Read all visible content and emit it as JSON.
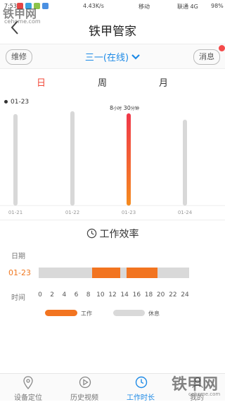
{
  "status_bar": {
    "time": "7:53",
    "speed": "4.43K/s",
    "carrier1": "移动",
    "carrier2": "联通 4G",
    "battery": "98%"
  },
  "watermark": {
    "top_text": "铁甲网",
    "top_sub": "cehome.com",
    "bottom_text": "铁甲网",
    "bottom_sub": "cehome.com"
  },
  "header": {
    "back_icon": "chevron-left-icon",
    "title": "铁甲管家"
  },
  "subbar": {
    "left_pill": "维修",
    "device": "三一(在线)",
    "right_pill": "消息"
  },
  "tabs": [
    {
      "label": "日",
      "active": true
    },
    {
      "label": "周",
      "active": false
    },
    {
      "label": "月",
      "active": false
    }
  ],
  "chart_data": {
    "type": "bar",
    "current_date": "01-23",
    "categories": [
      "01-21",
      "01-22",
      "01-23",
      "01-24"
    ],
    "values_hours": [
      0,
      0,
      8.5,
      0
    ],
    "selected_index": 2,
    "label_hours": "8",
    "label_hours_unit": "小时",
    "label_minutes": "30",
    "label_minutes_unit": "分钟",
    "colors": {
      "inactive": "#d8d8d8",
      "active_top": "#f0374a",
      "active_bottom": "#f58b1e"
    }
  },
  "efficiency": {
    "title": "工作效率",
    "date_label": "日期",
    "row_date": "01-23",
    "time_label": "时间",
    "ticks": [
      "0",
      "2",
      "4",
      "6",
      "8",
      "10",
      "12",
      "14",
      "16",
      "18",
      "20",
      "22",
      "24"
    ],
    "work_segments": [
      [
        8.5,
        13
      ],
      [
        14,
        19
      ]
    ],
    "legend_work": "工作",
    "legend_rest": "休息",
    "colors": {
      "work": "#f27420",
      "rest": "#d9d9d9"
    }
  },
  "bottom_nav": [
    {
      "label": "设备定位",
      "icon": "location-pin-icon",
      "active": false
    },
    {
      "label": "历史视频",
      "icon": "play-circle-icon",
      "active": false
    },
    {
      "label": "工作时长",
      "icon": "clock-icon",
      "active": true
    },
    {
      "label": "我的",
      "icon": "user-icon",
      "active": false
    }
  ]
}
